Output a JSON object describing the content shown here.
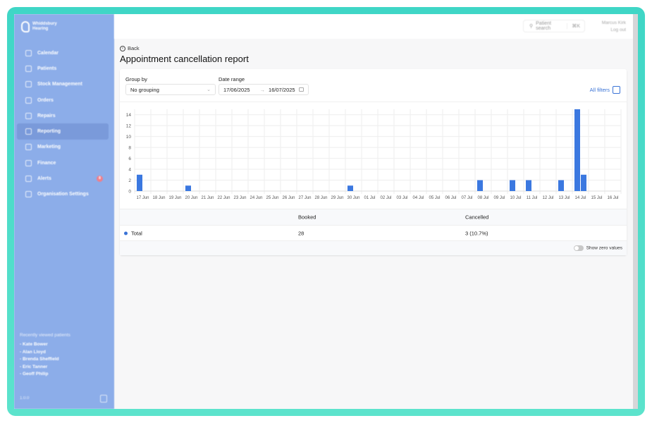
{
  "brand": {
    "name_line1": "Whiddsbury",
    "name_line2": "Hearing"
  },
  "sidebar": {
    "items": [
      {
        "label": "Calendar",
        "icon": "calendar-icon"
      },
      {
        "label": "Patients",
        "icon": "patients-icon"
      },
      {
        "label": "Stock Management",
        "icon": "box-icon"
      },
      {
        "label": "Orders",
        "icon": "orders-icon"
      },
      {
        "label": "Repairs",
        "icon": "wrench-icon"
      },
      {
        "label": "Reporting",
        "icon": "chart-pie-icon",
        "active": true
      },
      {
        "label": "Marketing",
        "icon": "mail-icon"
      },
      {
        "label": "Finance",
        "icon": "wallet-icon"
      },
      {
        "label": "Alerts",
        "icon": "bell-icon",
        "badge": "8"
      },
      {
        "label": "Organisation Settings",
        "icon": "gear-icon"
      }
    ],
    "recent_title": "Recently viewed patients",
    "recent": [
      "- Kate Bower",
      "- Alan Lloyd",
      "- Brenda Sheffield",
      "- Eric Tanner",
      "- Geoff Philip"
    ],
    "version": "1.0.0"
  },
  "topbar": {
    "search_placeholder": "Patient search",
    "shortcut": "⌘K",
    "user_name": "Marcus Kirk",
    "logout": "Log out"
  },
  "page": {
    "back": "Back",
    "title": "Appointment cancellation report"
  },
  "filters": {
    "group_by_label": "Group by",
    "group_by_value": "No grouping",
    "date_range_label": "Date range",
    "date_from": "17/06/2025",
    "date_to": "16/07/2025",
    "all_filters": "All filters"
  },
  "chart_data": {
    "type": "bar",
    "accent": "#3b78e0",
    "ylim": [
      0,
      15
    ],
    "yticks": [
      0,
      2,
      4,
      6,
      8,
      10,
      12,
      14
    ],
    "grid": true,
    "categories": [
      "17 Jun",
      "18 Jun",
      "19 Jun",
      "20 Jun",
      "21 Jun",
      "22 Jun",
      "23 Jun",
      "24 Jun",
      "25 Jun",
      "26 Jun",
      "27 Jun",
      "28 Jun",
      "29 Jun",
      "30 Jun",
      "01 Jul",
      "02 Jul",
      "03 Jul",
      "04 Jul",
      "05 Jul",
      "06 Jul",
      "07 Jul",
      "08 Jul",
      "09 Jul",
      "10 Jul",
      "11 Jul",
      "12 Jul",
      "13 Jul",
      "14 Jul",
      "15 Jul",
      "16 Jul"
    ],
    "series": [
      {
        "values": [
          3,
          0,
          0,
          1,
          0,
          0,
          0,
          0,
          0,
          0,
          0,
          0,
          0,
          1,
          0,
          0,
          0,
          0,
          0,
          0,
          0,
          2,
          0,
          2,
          2,
          0,
          2,
          15,
          0,
          0
        ]
      },
      {
        "values": [
          0,
          0,
          0,
          0,
          0,
          0,
          0,
          0,
          0,
          0,
          0,
          0,
          0,
          0,
          0,
          0,
          0,
          0,
          0,
          0,
          0,
          0,
          0,
          0,
          0,
          0,
          0,
          3,
          0,
          0
        ]
      }
    ]
  },
  "table": {
    "headers": [
      "",
      "Booked",
      "Cancelled"
    ],
    "rows": [
      {
        "label": "Total",
        "booked": "28",
        "cancelled": "3 (10.7%)"
      }
    ],
    "toggle_label": "Show zero values"
  }
}
